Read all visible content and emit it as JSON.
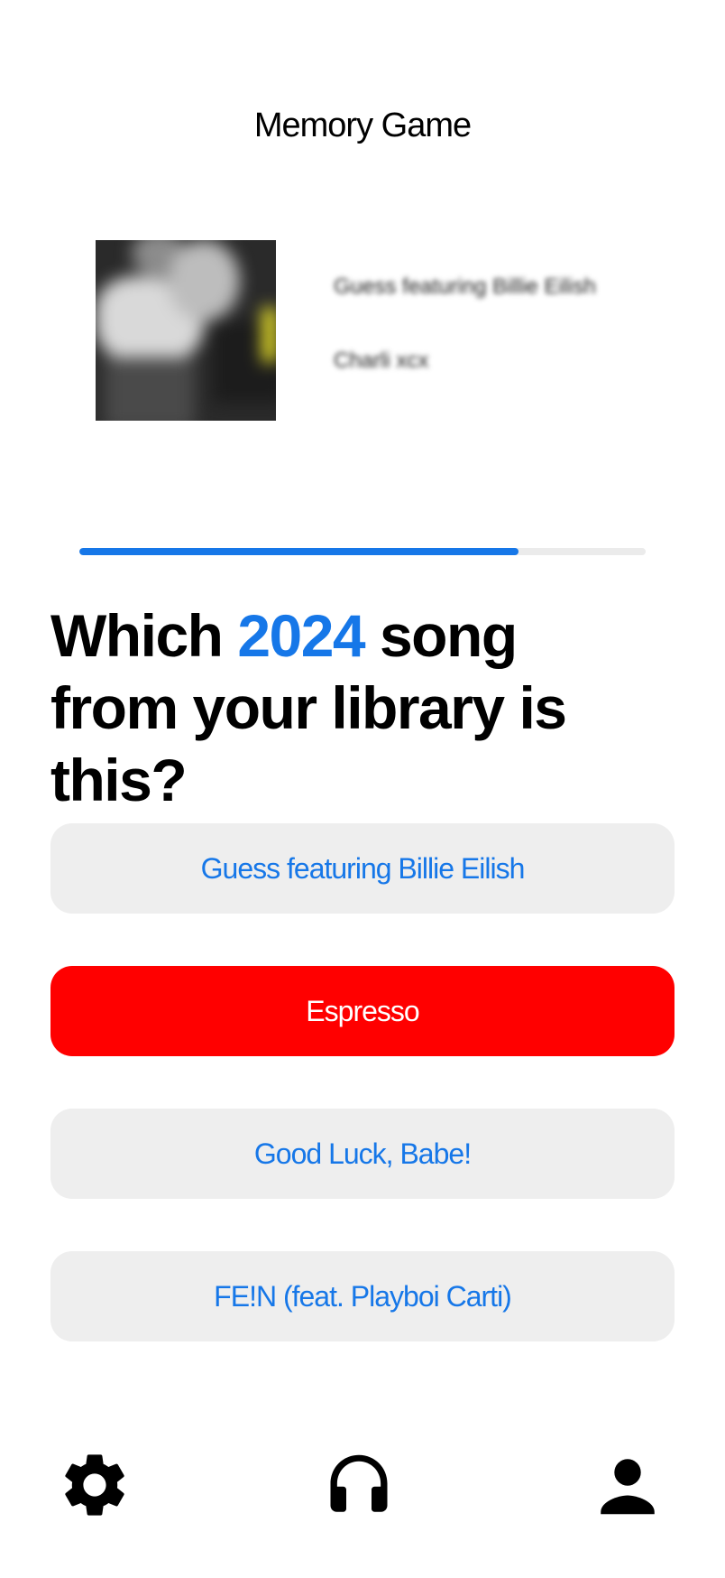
{
  "header": {
    "title": "Memory Game"
  },
  "now_playing": {
    "track_title": "Guess featuring Billie Eilish",
    "artist": "Charli xcx"
  },
  "progress": {
    "fraction": 0.775
  },
  "question": {
    "prefix": "Which ",
    "year": "2024",
    "suffix": " song",
    "line2": "from your library is this?"
  },
  "answers": [
    {
      "label": "Guess featuring Billie Eilish",
      "state": "default"
    },
    {
      "label": "Espresso",
      "state": "wrong"
    },
    {
      "label": "Good Luck, Babe!",
      "state": "default"
    },
    {
      "label": "FE!N (feat. Playboi Carti)",
      "state": "default"
    }
  ],
  "bottom_nav": {
    "items": [
      {
        "icon": "gear-icon"
      },
      {
        "icon": "headphones-icon"
      },
      {
        "icon": "person-icon"
      }
    ]
  },
  "colors": {
    "accent": "#1677e8",
    "wrong": "#ff0000",
    "option_bg": "#eeeeee",
    "progress_track": "#ebebeb"
  }
}
